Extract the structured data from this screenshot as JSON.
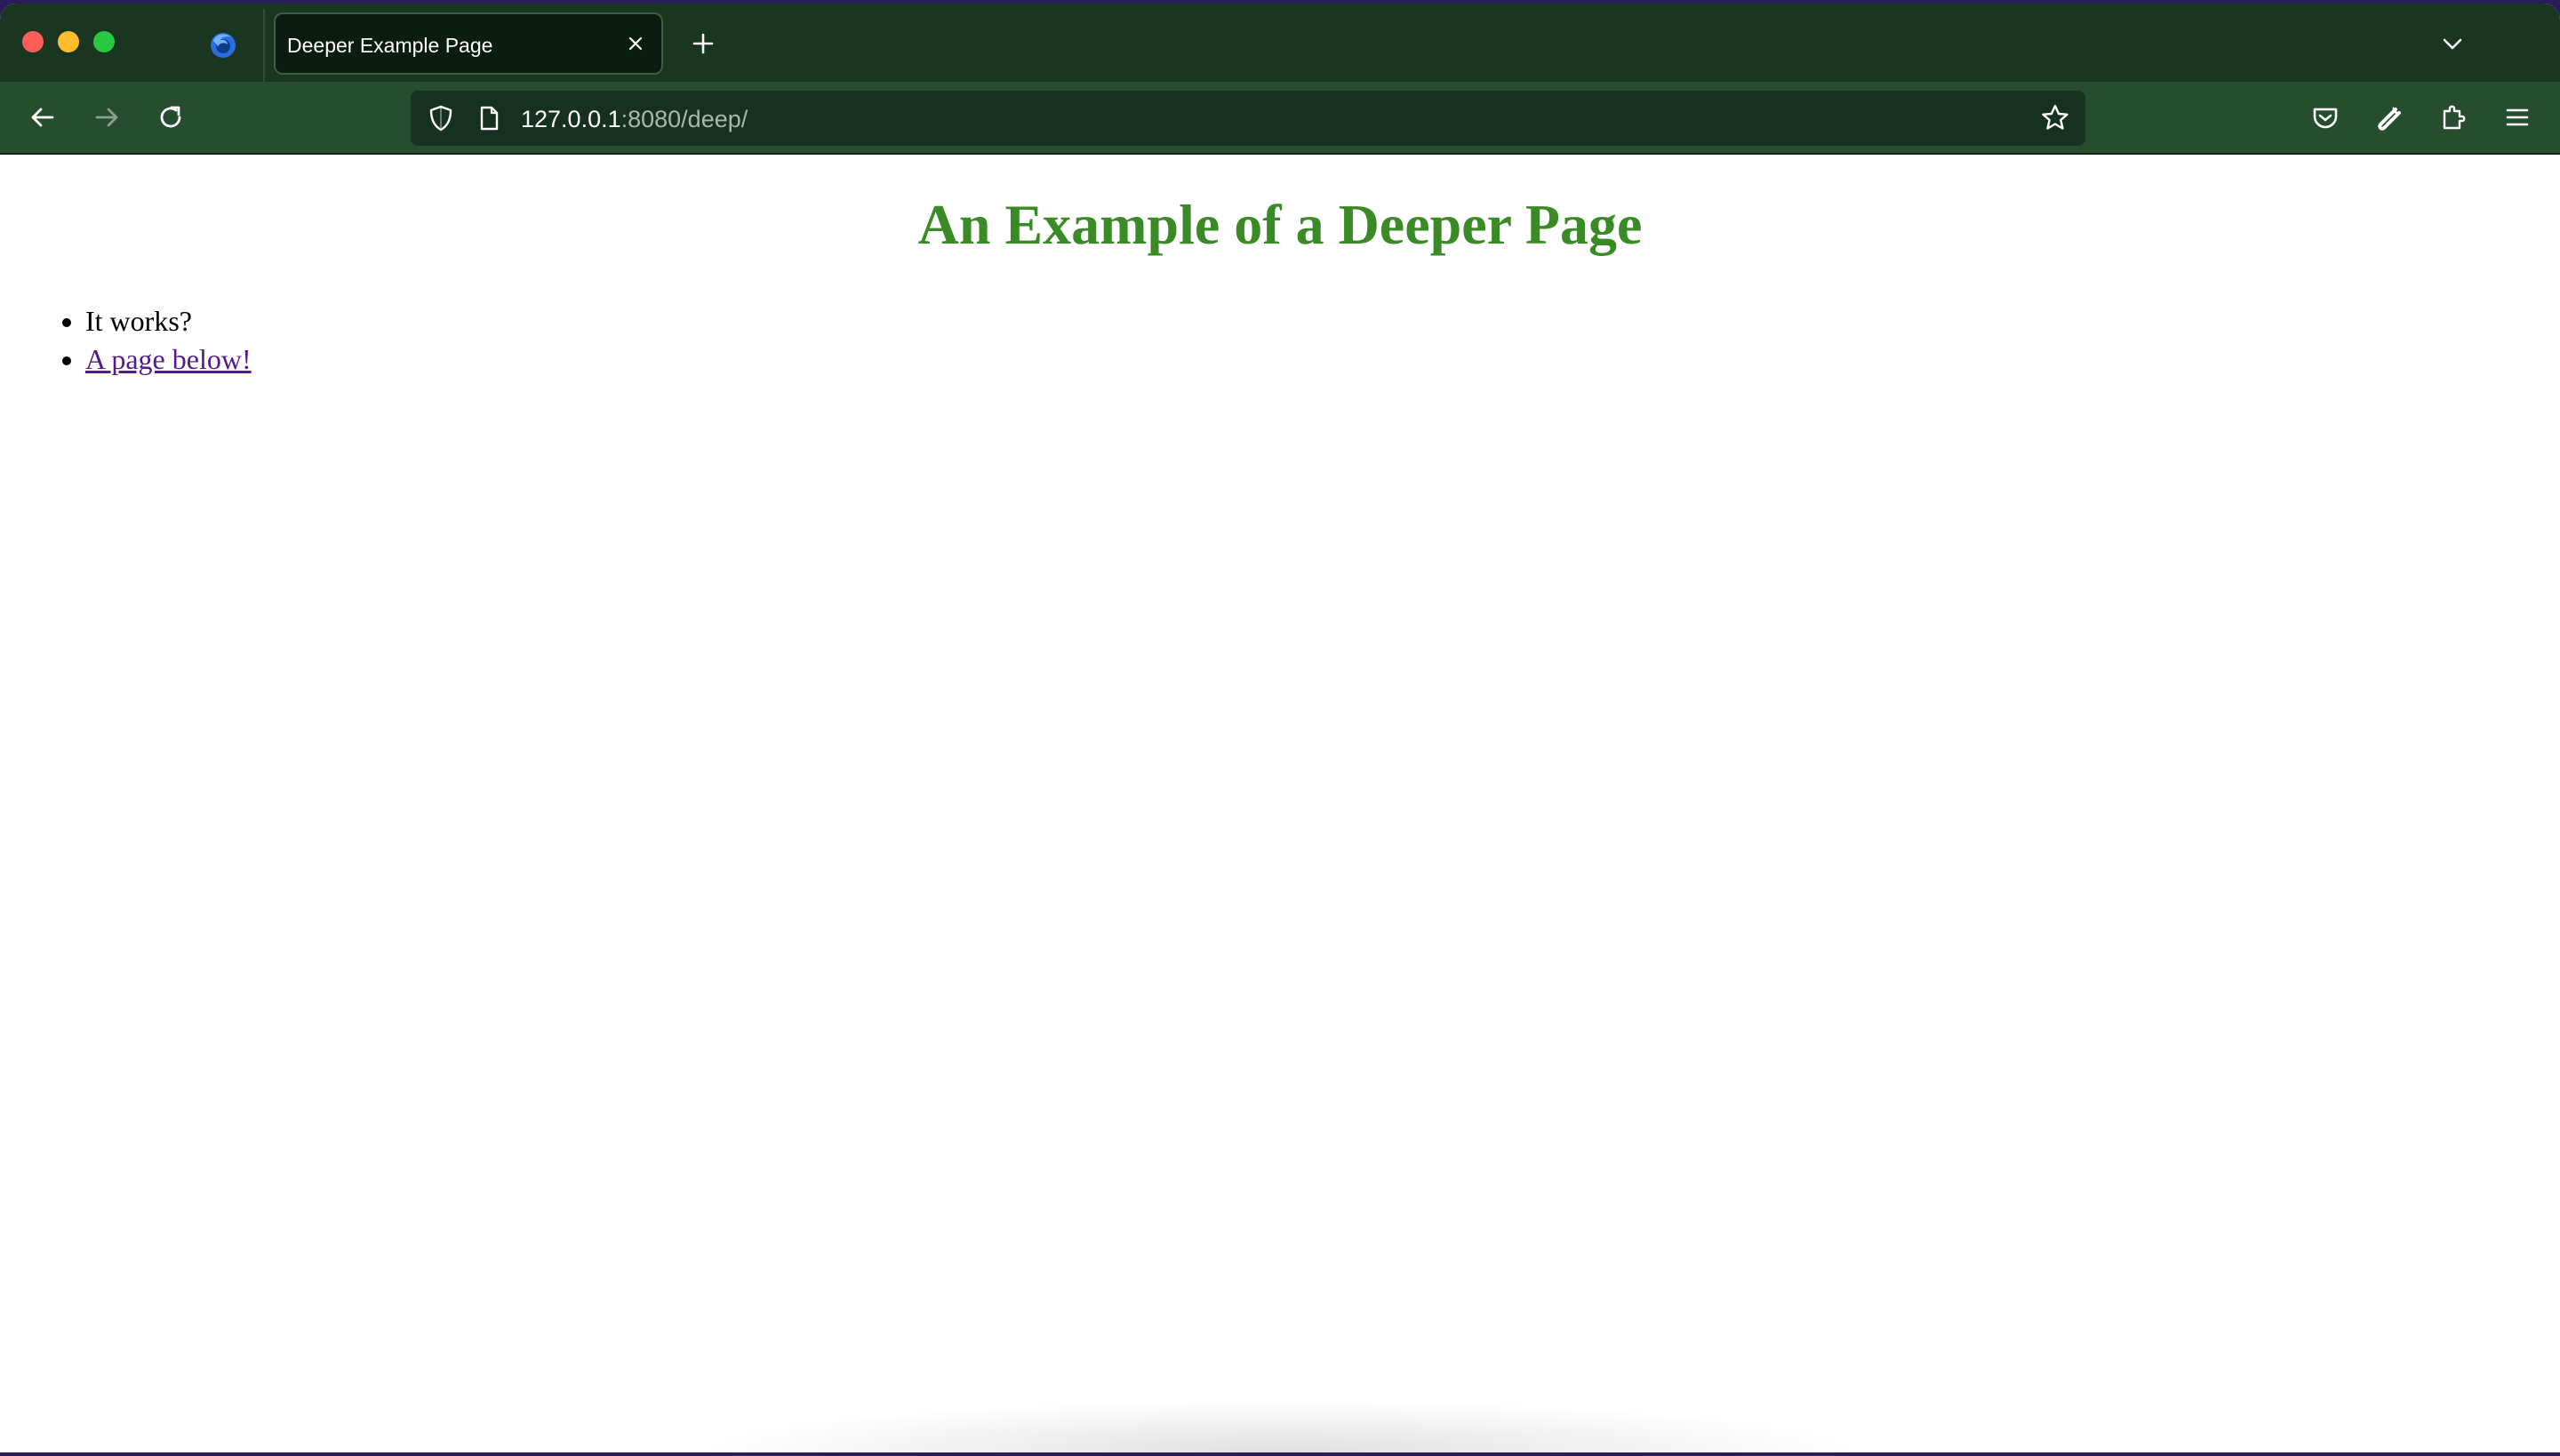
{
  "window": {
    "controls": [
      "close",
      "minimize",
      "maximize"
    ]
  },
  "tabs": [
    {
      "title": "Deeper Example Page",
      "active": true
    }
  ],
  "toolbar": {
    "icons": [
      "back-icon",
      "forward-icon",
      "reload-icon",
      "shield-icon",
      "page-icon",
      "bookmark-star-icon",
      "pocket-icon",
      "wrench-icon",
      "extensions-icon",
      "menu-icon"
    ]
  },
  "url": {
    "host": "127.0.0.1",
    "rest": ":8080/deep/"
  },
  "page": {
    "heading": "An Example of a Deeper Page",
    "items": [
      {
        "text": "It works?",
        "link": false
      },
      {
        "text": "A page below!",
        "link": true
      }
    ]
  },
  "colors": {
    "tabstrip": "#1a3620",
    "toolbar": "#254d2e",
    "heading": "#3a8a25",
    "visited_link": "#551a8b"
  }
}
